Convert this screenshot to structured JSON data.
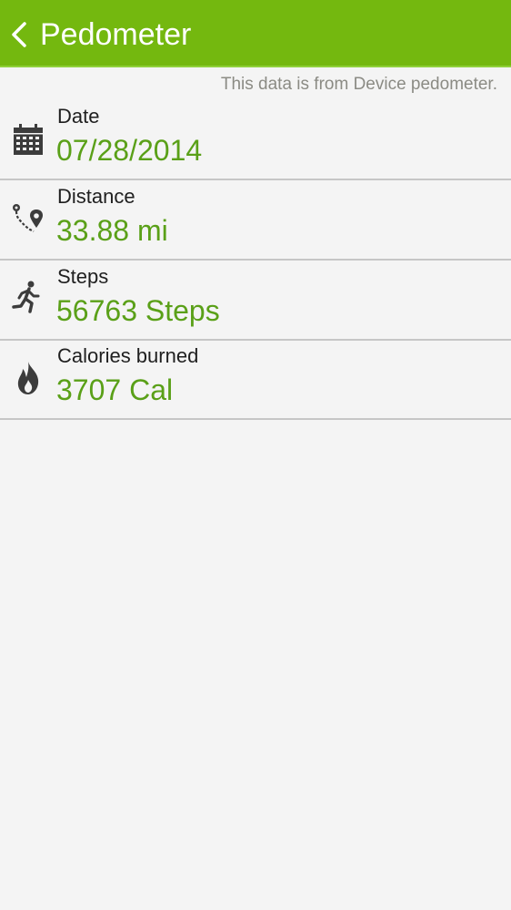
{
  "header": {
    "title": "Pedometer",
    "back_icon": "chevron-left-icon",
    "background_color": "#74b80f"
  },
  "source_note": "This data is from Device pedometer.",
  "accent_color": "#5aa018",
  "rows": [
    {
      "icon": "calendar-icon",
      "label": "Date",
      "value": "07/28/2014"
    },
    {
      "icon": "route-pin-icon",
      "label": "Distance",
      "value": "33.88 mi"
    },
    {
      "icon": "runner-icon",
      "label": "Steps",
      "value": "56763 Steps"
    },
    {
      "icon": "flame-icon",
      "label": "Calories burned",
      "value": "3707 Cal"
    }
  ]
}
